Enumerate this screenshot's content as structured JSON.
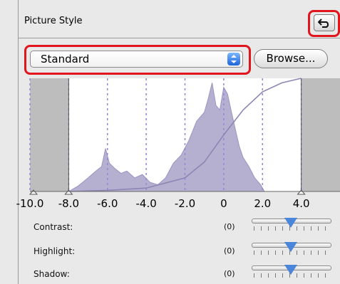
{
  "header": {
    "title": "Picture Style"
  },
  "style_select": {
    "value": "Standard"
  },
  "browse_button": {
    "label": "Browse..."
  },
  "colors": {
    "highlight": "#e0161c",
    "histogram_fill": "#b6b0d0",
    "curve": "#8e85b3",
    "guide_line": "#8f88d9"
  },
  "icons": {
    "reset": "undo-arrow-icon",
    "select_arrow": "stepper-arrows-icon"
  },
  "chart_data": {
    "type": "area",
    "x_tick_labels": [
      "-10.0",
      "-8.0",
      "-6.0",
      "-4.0",
      "-2.0",
      "0",
      "2.0",
      "4.0"
    ],
    "shaded_regions": [
      {
        "from": -10.0,
        "to": -8.0
      },
      {
        "from": 4.0,
        "to": 6.0
      }
    ],
    "histogram": {
      "x": [
        -8.0,
        -7.5,
        -7.0,
        -6.6,
        -6.3,
        -6.1,
        -5.9,
        -5.6,
        -5.3,
        -5.0,
        -4.6,
        -4.2,
        -3.8,
        -3.4,
        -3.0,
        -2.6,
        -2.2,
        -1.8,
        -1.4,
        -1.0,
        -0.8,
        -0.6,
        -0.4,
        -0.2,
        0.0,
        0.2,
        0.4,
        0.6,
        0.8,
        1.0,
        1.3,
        1.6,
        1.9,
        2.1
      ],
      "y": [
        0,
        0.05,
        0.12,
        0.18,
        0.22,
        0.38,
        0.25,
        0.2,
        0.16,
        0.18,
        0.12,
        0.15,
        0.08,
        0.06,
        0.12,
        0.25,
        0.32,
        0.45,
        0.62,
        0.7,
        0.82,
        0.96,
        0.76,
        0.72,
        0.92,
        0.86,
        0.7,
        0.55,
        0.4,
        0.3,
        0.22,
        0.12,
        0.06,
        0.0
      ],
      "ylim": [
        0,
        1
      ]
    },
    "tone_curve": {
      "x": [
        -8.0,
        -6.0,
        -4.0,
        -2.0,
        -1.0,
        0.0,
        1.0,
        2.0,
        3.0,
        4.0
      ],
      "y": [
        0.0,
        0.01,
        0.03,
        0.12,
        0.26,
        0.5,
        0.72,
        0.88,
        0.96,
        1.0
      ]
    },
    "xlim": [
      -10.0,
      6.0
    ],
    "ylim": [
      0,
      1
    ]
  },
  "adjustments": [
    {
      "label": "Contrast:",
      "value": "(0)",
      "level": 0.5
    },
    {
      "label": "Highlight:",
      "value": "(0)",
      "level": 0.5
    },
    {
      "label": "Shadow:",
      "value": "(0)",
      "level": 0.5
    }
  ]
}
